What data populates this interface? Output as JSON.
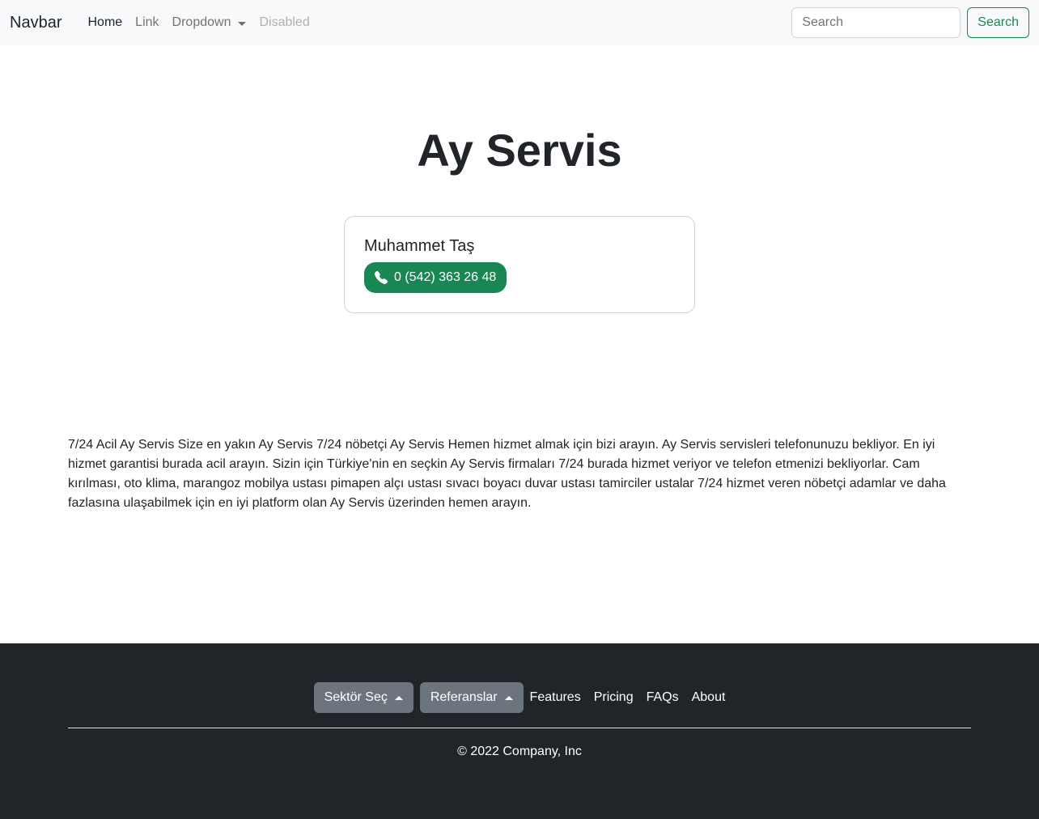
{
  "navbar": {
    "brand": "Navbar",
    "links": [
      {
        "label": "Home",
        "state": "active"
      },
      {
        "label": "Link",
        "state": "normal"
      },
      {
        "label": "Dropdown",
        "state": "dropdown"
      },
      {
        "label": "Disabled",
        "state": "disabled"
      }
    ],
    "search": {
      "placeholder": "Search",
      "value": "",
      "button_label": "Search"
    }
  },
  "hero": {
    "title": "Ay Servis"
  },
  "contact_card": {
    "name": "Muhammet Taş",
    "phone": "0 (542) 363 26 48",
    "icon": "phone-icon"
  },
  "description": "7/24 Acil Ay Servis Size en yakın Ay Servis 7/24 nöbetçi Ay Servis Hemen hizmet almak için bizi arayın. Ay Servis servisleri telefonunuzu bekliyor. En iyi hizmet garantisi burada acil arayın. Sizin için Türkiye'nin en seçkin Ay Servis firmaları 7/24 burada hizmet veriyor ve telefon etmenizi bekliyorlar. Cam kırılması, oto klima, marangoz mobilya ustası pimapen alçı ustası sıvacı boyacı duvar ustası tamirciler ustalar 7/24 hizmet veren nöbetçi adamlar ve daha fazlasına ulaşabilmek için en iyi platform olan Ay Servis üzerinden hemen arayın.",
  "footer": {
    "dropdowns": [
      "Sektör Seç",
      "Referanslar"
    ],
    "links": [
      "Features",
      "Pricing",
      "FAQs",
      "About"
    ],
    "copyright": "© 2022 Company, Inc"
  },
  "colors": {
    "success": "#198754",
    "secondary": "#6c757d",
    "dark": "#212529",
    "light": "#f8f9fa"
  }
}
